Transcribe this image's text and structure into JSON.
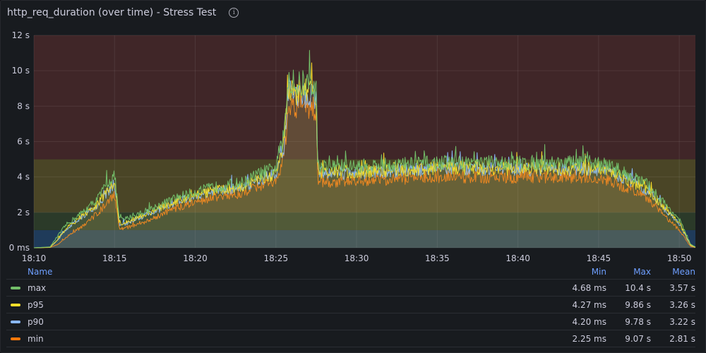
{
  "panel": {
    "title": "http_req_duration (over time) - Stress Test",
    "info_icon": "info-circle-icon"
  },
  "legend": {
    "headers": {
      "name": "Name",
      "min": "Min",
      "max": "Max",
      "mean": "Mean"
    },
    "rows": [
      {
        "name": "max",
        "color": "#73bf69",
        "min": "4.68 ms",
        "max": "10.4 s",
        "mean": "3.57 s"
      },
      {
        "name": "p95",
        "color": "#fade2a",
        "min": "4.27 ms",
        "max": "9.86 s",
        "mean": "3.26 s"
      },
      {
        "name": "p90",
        "color": "#8ab8ff",
        "min": "4.20 ms",
        "max": "9.78 s",
        "mean": "3.22 s"
      },
      {
        "name": "min",
        "color": "#ff780a",
        "min": "2.25 ms",
        "max": "9.07 s",
        "mean": "2.81 s"
      }
    ]
  },
  "chart_data": {
    "type": "line",
    "x_ticks": [
      "18:10",
      "18:15",
      "18:20",
      "18:25",
      "18:30",
      "18:35",
      "18:40",
      "18:45",
      "18:50"
    ],
    "y_ticks": [
      "0 ms",
      "2 s",
      "4 s",
      "6 s",
      "8 s",
      "10 s",
      "12 s"
    ],
    "ylim": [
      0,
      12
    ],
    "grid": true,
    "legend_placement": "bottom",
    "thresholds": [
      {
        "from": 0,
        "to": 1,
        "color": "#1f3b5a"
      },
      {
        "from": 1,
        "to": 2,
        "color": "#2b3a29"
      },
      {
        "from": 2,
        "to": 5,
        "color": "#4a4526"
      },
      {
        "from": 5,
        "to": 12,
        "color": "#402628"
      }
    ],
    "x_minutes": [
      0,
      1,
      1.5,
      2,
      3,
      4,
      4.5,
      5,
      5.3,
      5.6,
      7,
      9,
      11,
      13,
      14,
      15,
      15.5,
      15.8,
      16,
      17,
      17.5,
      17.6,
      20,
      25,
      30,
      35,
      36,
      38,
      40,
      40.7,
      41
    ],
    "series": [
      {
        "name": "max",
        "color": "#73bf69",
        "values": [
          0,
          0.05,
          0.7,
          1.3,
          2,
          2.8,
          3.6,
          4.1,
          1.6,
          1.6,
          2.1,
          2.9,
          3.4,
          3.7,
          4.2,
          4.5,
          6.3,
          9.9,
          9.1,
          9.3,
          8.9,
          4.6,
          4.6,
          4.8,
          4.8,
          4.8,
          4.5,
          3.6,
          1.6,
          0.2,
          0.05
        ]
      },
      {
        "name": "p95",
        "color": "#fade2a",
        "values": [
          0,
          0.03,
          0.5,
          1.1,
          1.8,
          2.5,
          3.2,
          3.7,
          1.4,
          1.4,
          1.9,
          2.7,
          3.2,
          3.5,
          3.9,
          4.2,
          5.9,
          9.2,
          8.7,
          8.8,
          8.5,
          4.3,
          4.3,
          4.5,
          4.5,
          4.5,
          4.2,
          3.3,
          1.4,
          0.15,
          0.03
        ]
      },
      {
        "name": "p90",
        "color": "#8ab8ff",
        "values": [
          0,
          0.03,
          0.45,
          1.05,
          1.75,
          2.45,
          3.1,
          3.6,
          1.35,
          1.35,
          1.85,
          2.65,
          3.15,
          3.45,
          3.85,
          4.15,
          5.8,
          9.1,
          8.6,
          8.7,
          8.4,
          4.25,
          4.25,
          4.45,
          4.45,
          4.45,
          4.15,
          3.25,
          1.35,
          0.14,
          0.03
        ]
      },
      {
        "name": "min",
        "color": "#ff780a",
        "values": [
          0,
          0.02,
          0.2,
          0.6,
          1.2,
          2.0,
          2.5,
          3.0,
          1.1,
          1.1,
          1.5,
          2.3,
          2.8,
          3.1,
          3.5,
          3.7,
          5.0,
          8.3,
          7.9,
          8.0,
          7.8,
          3.7,
          3.8,
          4.0,
          4.0,
          4.0,
          3.7,
          2.8,
          1.0,
          0.08,
          0.02
        ]
      }
    ]
  }
}
